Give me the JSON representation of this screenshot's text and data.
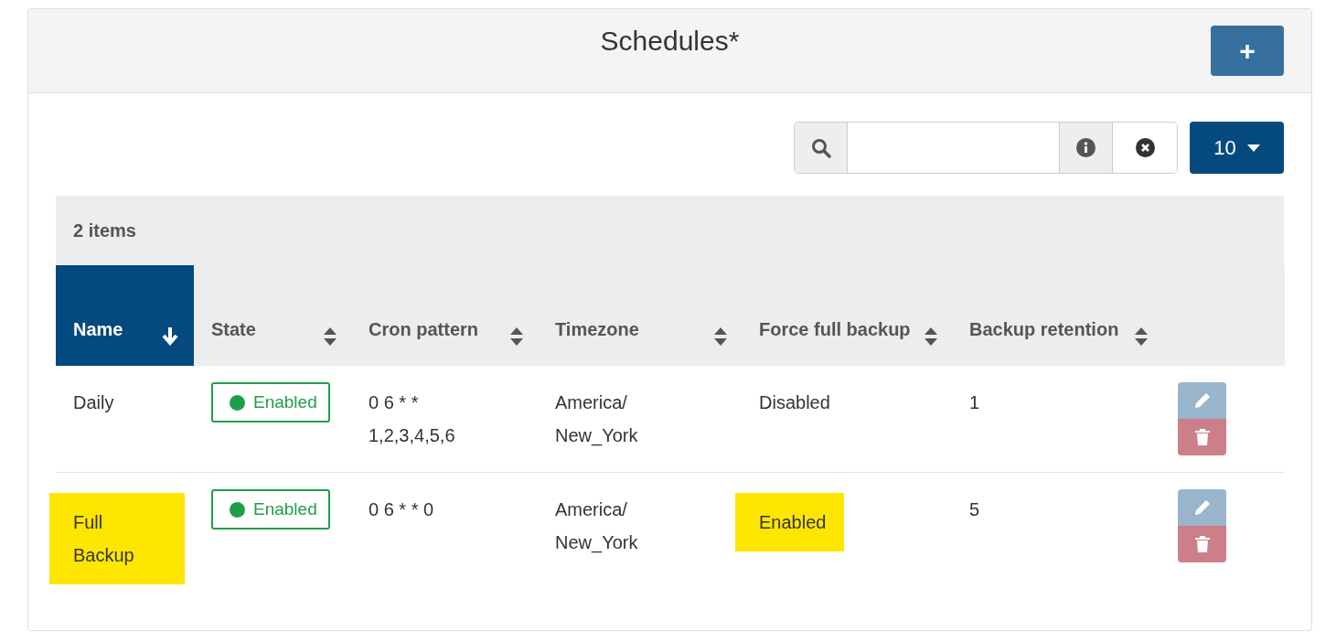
{
  "title": "Schedules*",
  "add_button": {
    "label": "+"
  },
  "page_size": {
    "label": "10"
  },
  "item_count": "2 items",
  "columns": [
    {
      "label": "Name",
      "sorted": true
    },
    {
      "label": "State",
      "sorted": false
    },
    {
      "label": "Cron pattern",
      "sorted": false
    },
    {
      "label": "Timezone",
      "sorted": false
    },
    {
      "label": "Force full backup",
      "sorted": false
    },
    {
      "label": "Backup retention",
      "sorted": false
    }
  ],
  "rows": [
    {
      "name": {
        "text": "Daily",
        "highlighted": false
      },
      "state": {
        "label": "Enabled",
        "on": true
      },
      "cron": "0 6 * * 1,2,3,4,5,6",
      "timezone": "America/ New_York",
      "force_full_backup": {
        "text": "Disabled",
        "highlighted": false
      },
      "retention": "1"
    },
    {
      "name": {
        "text": "Full Backup",
        "highlighted": true
      },
      "state": {
        "label": "Enabled",
        "on": true
      },
      "cron": "0 6 * * 0",
      "timezone": "America/ New_York",
      "force_full_backup": {
        "text": "Enabled",
        "highlighted": true
      },
      "retention": "5"
    }
  ]
}
